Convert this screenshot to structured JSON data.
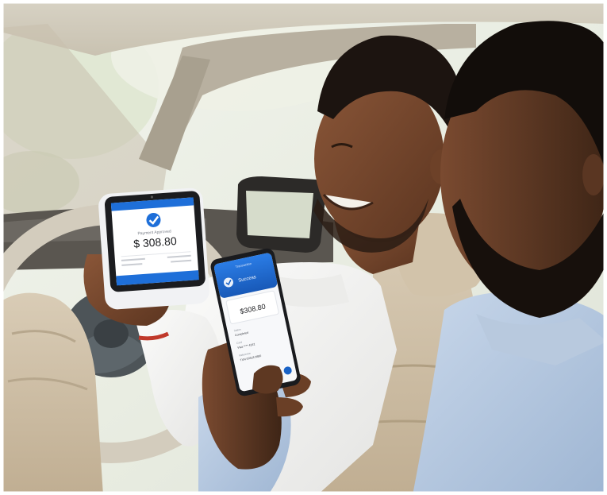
{
  "scene": {
    "description_icons": [
      "pos-terminal-device",
      "smartphone-device",
      "car-interior"
    ]
  },
  "terminal": {
    "status_text": "Payment Approved",
    "amount": "$ 308.80",
    "accent_color": "#1e6fd9"
  },
  "phone": {
    "header_text": "Transaction",
    "status_text": "Success",
    "amount": "$308.80",
    "line1_label": "Status",
    "line1_value": "Completed",
    "line2_label": "Card",
    "line2_value": "Visa **** 4242",
    "line3_label": "Reference",
    "line3_value": "TXN 00318 0880",
    "accent_color": "#1a63c7"
  }
}
